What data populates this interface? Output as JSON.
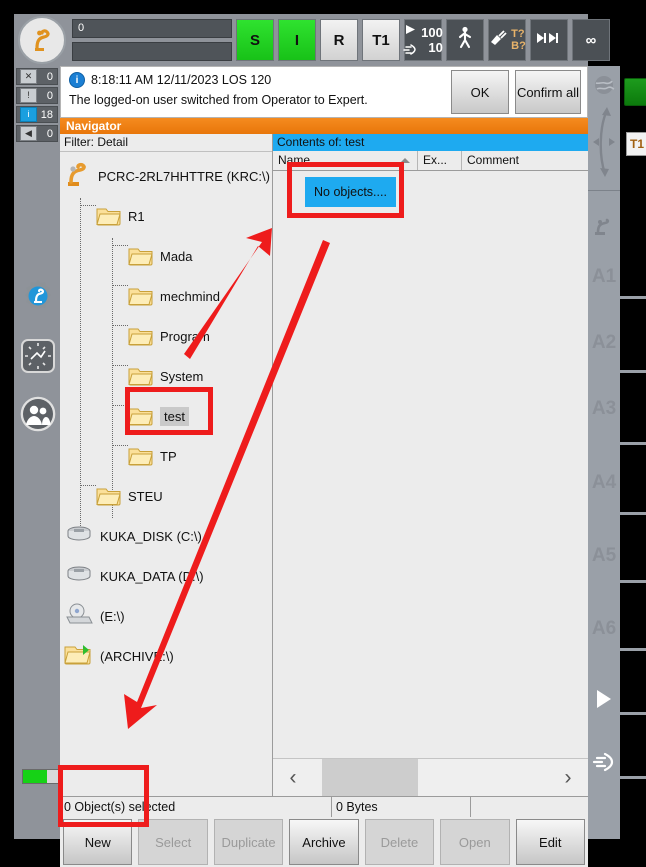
{
  "topbar": {
    "logo_icon": "kuka-robot-logo-icon",
    "bar_value": "0",
    "buttons": [
      {
        "name": "s-status-button",
        "label": "S",
        "state": "green"
      },
      {
        "name": "i-status-button",
        "label": "I",
        "state": "green"
      },
      {
        "name": "r-status-button",
        "label": "R",
        "state": "grey"
      },
      {
        "name": "t1-mode-button",
        "label": "T1",
        "state": "grey"
      }
    ],
    "override": {
      "program_speed": "100",
      "jog_speed": "10"
    },
    "manual_icon": "walking-person-icon",
    "tool_base": {
      "tool": "T?",
      "base": "B?"
    },
    "increment_icon": "increment-arrows-icon",
    "increment_value": "∞"
  },
  "message_counters": [
    {
      "name": "ack-message-counter",
      "icon": "x-ack-icon",
      "count": "0"
    },
    {
      "name": "warning-message-counter",
      "icon": "exclamation-icon",
      "count": "0"
    },
    {
      "name": "info-message-counter",
      "icon": "info-icon",
      "count": "18"
    },
    {
      "name": "wait-message-counter",
      "icon": "wait-icon",
      "count": "0"
    }
  ],
  "left_rail_icons": [
    {
      "name": "settings-gear-icon"
    },
    {
      "name": "clock-icon"
    },
    {
      "name": "users-icon"
    }
  ],
  "message": {
    "icon": "info-icon",
    "header": "8:18:11 AM 12/11/2023 LOS 120",
    "body": "The logged-on user switched from Operator to Expert.",
    "ok_label": "OK",
    "confirm_all_label": "Confirm all"
  },
  "navigator": {
    "title": "Navigator",
    "filter_label": "Filter: Detail",
    "tree": [
      {
        "name": "tree-item-controller",
        "label": "PCRC-2RL7HHTTRE (KRC:\\)",
        "icon": "robot-icon",
        "depth": 0,
        "selected": false
      },
      {
        "name": "tree-item-r1",
        "label": "R1",
        "icon": "folder-icon",
        "depth": 1,
        "selected": false
      },
      {
        "name": "tree-item-mada",
        "label": "Mada",
        "icon": "folder-icon",
        "depth": 2,
        "selected": false
      },
      {
        "name": "tree-item-mechmind",
        "label": "mechmind",
        "icon": "folder-icon",
        "depth": 2,
        "selected": false
      },
      {
        "name": "tree-item-program",
        "label": "Program",
        "icon": "folder-icon",
        "depth": 2,
        "selected": false
      },
      {
        "name": "tree-item-system",
        "label": "System",
        "icon": "folder-icon",
        "depth": 2,
        "selected": false
      },
      {
        "name": "tree-item-test",
        "label": "test",
        "icon": "folder-icon",
        "depth": 2,
        "selected": true
      },
      {
        "name": "tree-item-tp",
        "label": "TP",
        "icon": "folder-icon",
        "depth": 2,
        "selected": false
      },
      {
        "name": "tree-item-steu",
        "label": "STEU",
        "icon": "folder-icon",
        "depth": 1,
        "selected": false
      },
      {
        "name": "tree-item-kuka-disk",
        "label": "KUKA_DISK (C:\\)",
        "icon": "drive-icon",
        "depth": 0,
        "selected": false
      },
      {
        "name": "tree-item-kuka-data",
        "label": "KUKA_DATA (D:\\)",
        "icon": "drive-icon",
        "depth": 0,
        "selected": false
      },
      {
        "name": "tree-item-e-drive",
        "label": "(E:\\)",
        "icon": "cd-drive-icon",
        "depth": 0,
        "selected": false
      },
      {
        "name": "tree-item-archive",
        "label": "(ARCHIVE:\\)",
        "icon": "archive-folder-icon",
        "depth": 0,
        "selected": false
      }
    ],
    "contents_title": "Contents of: test",
    "columns": [
      {
        "name": "column-header-name",
        "label": "Name"
      },
      {
        "name": "column-header-ext",
        "label": "Ex..."
      },
      {
        "name": "column-header-comment",
        "label": "Comment"
      }
    ],
    "empty_message": "No objects....",
    "scroll_left_icon": "chevron-left-icon",
    "scroll_right_icon": "chevron-right-icon",
    "status": {
      "selection": "0 Object(s) selected",
      "size": "0 Bytes",
      "extra": ""
    },
    "action_buttons": [
      {
        "name": "new-button",
        "label": "New",
        "enabled": true
      },
      {
        "name": "select-button",
        "label": "Select",
        "enabled": false
      },
      {
        "name": "duplicate-button",
        "label": "Duplicate",
        "enabled": false
      },
      {
        "name": "archive-button",
        "label": "Archive",
        "enabled": true
      },
      {
        "name": "delete-button",
        "label": "Delete",
        "enabled": false
      },
      {
        "name": "open-button",
        "label": "Open",
        "enabled": false
      },
      {
        "name": "edit-button",
        "label": "Edit",
        "enabled": true
      }
    ]
  },
  "right_rail": {
    "world-icon": "world-coordinate-icon",
    "motion-icon": "motion-arrows-icon",
    "robot-icon": "robot-axis-icon",
    "axes": [
      "A1",
      "A2",
      "A3",
      "A4",
      "A5",
      "A6"
    ],
    "play_icon": "play-triangle-icon",
    "hand_icon": "hand-icon",
    "mode_badge": "T1"
  },
  "colors": {
    "navigator_title": "#f58b1f",
    "contents_header": "#1eaaf0",
    "annotation_red": "#ee1c1c",
    "status_green": "#18c218"
  }
}
